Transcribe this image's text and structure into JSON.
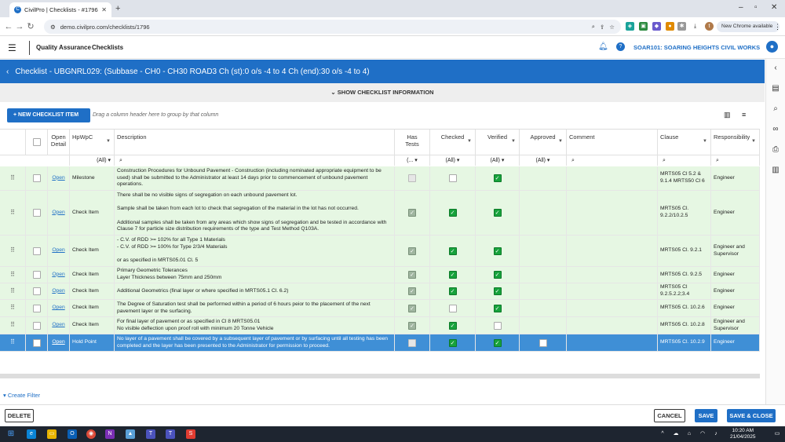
{
  "browser": {
    "tab_title": "CivilPro | Checklists - #1796",
    "url": "demo.civilpro.com/checklists/1796",
    "update_label": "New Chrome available",
    "profile_initial": "t"
  },
  "app": {
    "module": "Quality Assurance",
    "section": "Checklists",
    "project": "SOAR101: SOARING HEIGHTS CIVIL WORKS"
  },
  "title": "Checklist - UBGNRL029: (Subbase - CH0 - CH30 ROAD3 Ch (st):0 o/s -4 to 4 Ch (end):30 o/s -4 to 4)",
  "show_info_label": "SHOW CHECKLIST INFORMATION",
  "toolbar": {
    "new_item_label": "NEW CHECKLIST ITEM",
    "group_hint": "Drag a column header here to group by that column"
  },
  "columns": {
    "open_detail": "Open\nDetail",
    "hpwpc": "HpWpC",
    "description": "Description",
    "has_tests": "Has\nTests",
    "checked": "Checked",
    "verified": "Verified",
    "approved": "Approved",
    "comment": "Comment",
    "clause": "Clause",
    "responsibility": "Responsibility"
  },
  "filters": {
    "hpwpc": "(All)",
    "has_tests": "(...",
    "checked": "(All)",
    "verified": "(All)",
    "approved": "(All)"
  },
  "rows": [
    {
      "open": "Open",
      "type": "Milestone",
      "description": "Construction Procedures for Unbound Pavement - Construction (including nominated appropriate equipment to be used) shall be submitted to the Administrator at least 14 days prior to commencement of unbound pavement operations.",
      "has_tests": false,
      "checked": false,
      "verified": true,
      "approved": false,
      "clause": "MRTS05 Cl 5.2 &\n9.1.4 MRTS50 Cl 6",
      "responsibility": "Engineer"
    },
    {
      "open": "Open",
      "type": "Check Item",
      "description": "There shall be no visible signs of segregation on each unbound pavement lot.\n\nSample shall be taken from each lot to check that segregation of the material in the lot has not occurred.\n\nAdditional samples shall be taken from any areas which show signs of segregation and be tested in accordance with Clause 7 for particle size distribution requirements of the type and Test Method Q103A.",
      "has_tests": true,
      "checked": true,
      "verified": true,
      "approved": false,
      "clause": "MRTS05 Cl.\n9.2.2/10.2.5",
      "responsibility": "Engineer"
    },
    {
      "open": "Open",
      "type": "Check Item",
      "description": "- C.V. of RDD >= 102% for all Type 1 Materials\n- C.V. of RDD >= 100% for Type 2/3/4 Materials\n\nor as specified in MRTS05.01 Cl. 5",
      "has_tests": true,
      "checked": true,
      "verified": true,
      "approved": false,
      "clause": "MRTS05 Cl. 9.2.1",
      "responsibility": "Engineer and\nSupervisor"
    },
    {
      "open": "Open",
      "type": "Check Item",
      "description": "Primary Geometric Tolerances\nLayer Thickness between 75mm and 250mm",
      "has_tests": true,
      "checked": true,
      "verified": true,
      "approved": false,
      "clause": "MRTS05 Cl. 9.2.5",
      "responsibility": "Engineer"
    },
    {
      "open": "Open",
      "type": "Check Item",
      "description": "Additional Geometrics (final layer or where specified in MRTS05.1 Cl. 6.2)",
      "has_tests": true,
      "checked": true,
      "verified": true,
      "approved": false,
      "clause": "MRTS05 Cl\n9.2.5.2.2;3.4",
      "responsibility": "Engineer"
    },
    {
      "open": "Open",
      "type": "Check Item",
      "description": "The Degree of Saturation test shall be performed within a period of 6 hours peior to the placement of the next pavement layer or the surfacing.",
      "has_tests": true,
      "checked": false,
      "verified": true,
      "approved": false,
      "clause": "MRTS05 Cl. 10.2.6",
      "responsibility": "Engineer"
    },
    {
      "open": "Open",
      "type": "Check Item",
      "description": "For final layer of pavement or as specified in Cl 8 MRTS05.01\nNo visible deflection upon proof roll with minimum 20 Tonne Vehicle",
      "has_tests": true,
      "checked": true,
      "verified": false,
      "approved": false,
      "clause": "MRTS05 Cl. 10.2.8",
      "responsibility": "Engineer and\nSupervisor"
    },
    {
      "open": "Open",
      "type": "Hold Point",
      "description": "No layer of a pavement shall be covered by a subsequent layer of pavement or by surfacing until all testing has been completed and the layer has been presented to the Administrator for permission to proceed.",
      "has_tests": false,
      "checked": true,
      "verified": true,
      "approved": false,
      "clause": "MRTS05 Cl. 10.2.9",
      "responsibility": "Engineer"
    }
  ],
  "create_filter_label": "Create Filter",
  "footer": {
    "delete_label": "DELETE",
    "cancel_label": "CANCEL",
    "save_label": "SAVE",
    "save_close_label": "SAVE & CLOSE"
  },
  "taskbar": {
    "time": "10:20 AM",
    "date": "21/04/2025"
  },
  "colors": {
    "primary": "#1f6fc6",
    "row_bg": "#e6f7e3",
    "selected_bg": "#3f8fd6",
    "check_green": "#17a23c"
  }
}
